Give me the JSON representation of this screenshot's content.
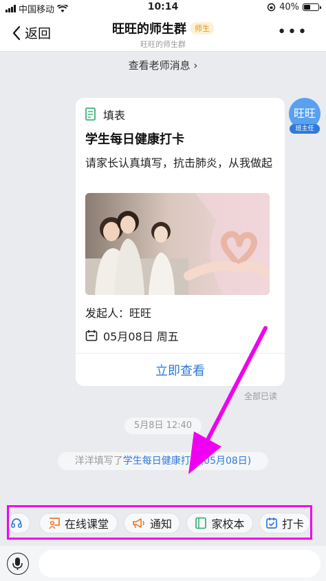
{
  "status_bar": {
    "carrier": "中国移动",
    "time": "10:14",
    "battery_percent": "40%",
    "battery_level": 0.4
  },
  "nav": {
    "back_label": "返回",
    "title": "旺旺的师生群",
    "badge": "师生",
    "subtitle": "旺旺的师生群",
    "more_label": "•••"
  },
  "teacher_messages_link": "查看老师消息 ›",
  "sender": {
    "avatar_text": "旺旺",
    "role_tag": "班主任"
  },
  "card": {
    "type_label": "填表",
    "title": "学生每日健康打卡",
    "description": "请家长认真填写，抗击肺炎，从我做起",
    "initiator": "发起人：旺旺",
    "date": "05月08日 周五",
    "action_label": "立即查看"
  },
  "read_status": "全部已读",
  "timestamp": "5月8日 12:40",
  "system_message": {
    "prefix": "洋洋填写了",
    "link": "学生每日健康打卡",
    "suffix": "(05月08日)"
  },
  "quick_actions": [
    {
      "label": "",
      "icon": "headset-icon"
    },
    {
      "label": "在线课堂",
      "icon": "online-class-icon"
    },
    {
      "label": "通知",
      "icon": "megaphone-icon"
    },
    {
      "label": "家校本",
      "icon": "notebook-icon"
    },
    {
      "label": "打卡",
      "icon": "checkin-icon"
    }
  ],
  "colors": {
    "accent": "#2f7bd9",
    "highlight": "#f000f0",
    "background": "#e9ebee"
  }
}
